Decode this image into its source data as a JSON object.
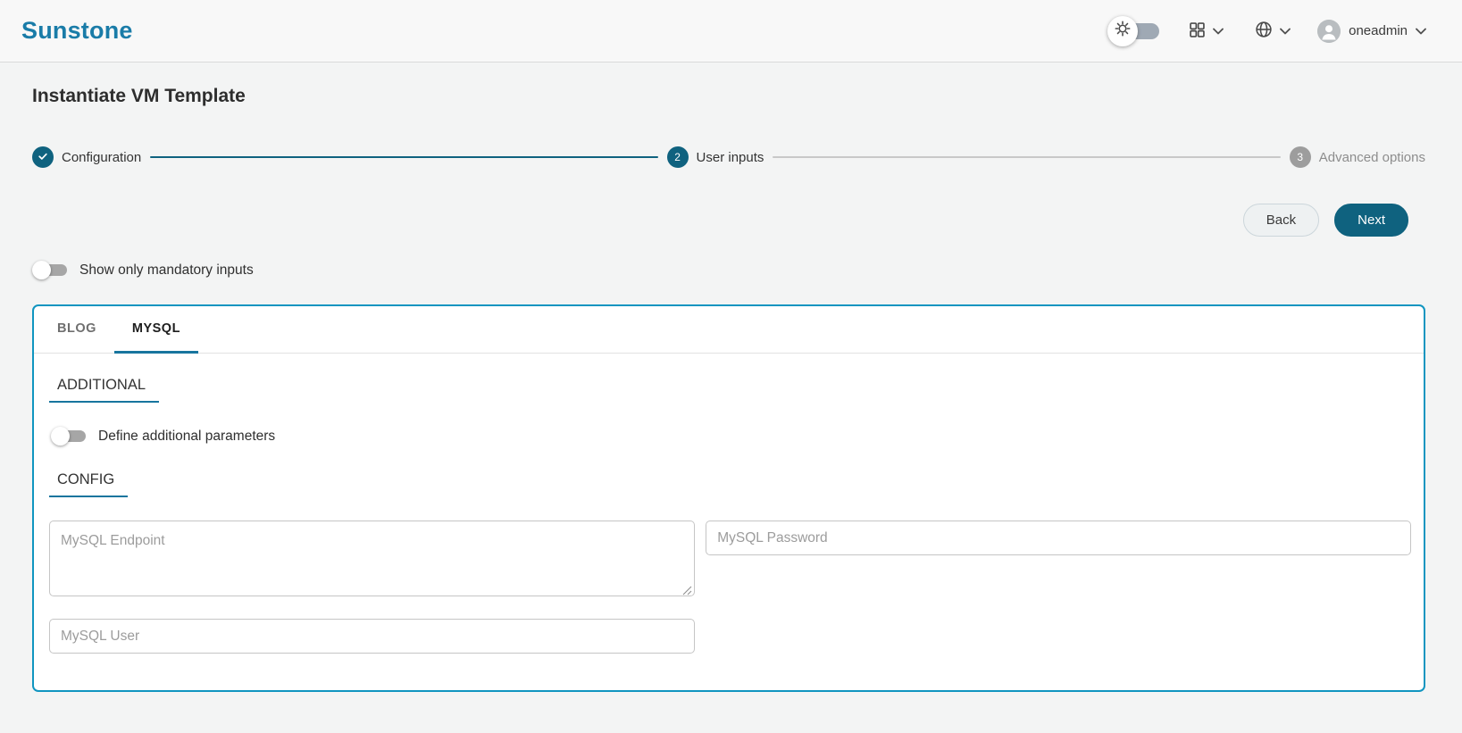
{
  "header": {
    "logo_text": "Sunstone",
    "username": "oneadmin"
  },
  "page_title": "Instantiate VM Template",
  "stepper": {
    "steps": [
      {
        "label": "Configuration",
        "status": "completed"
      },
      {
        "number": "2",
        "label": "User inputs",
        "status": "active"
      },
      {
        "number": "3",
        "label": "Advanced options",
        "status": "upcoming"
      }
    ]
  },
  "wizard_actions": {
    "back": "Back",
    "next": "Next"
  },
  "mandatory_toggle": {
    "label": "Show only mandatory inputs",
    "enabled": false
  },
  "user_inputs_card": {
    "tabs": [
      {
        "label": "BLOG",
        "active": false
      },
      {
        "label": "MYSQL",
        "active": true
      }
    ],
    "additional_section": {
      "title": "ADDITIONAL",
      "toggle_label": "Define additional parameters",
      "toggle_enabled": false
    },
    "config_section": {
      "title": "CONFIG",
      "fields": {
        "endpoint": {
          "placeholder": "MySQL Endpoint",
          "value": "",
          "type": "textarea"
        },
        "password": {
          "placeholder": "MySQL Password",
          "value": "",
          "type": "text"
        },
        "user": {
          "placeholder": "MySQL User",
          "value": "",
          "type": "text"
        }
      }
    }
  },
  "icons": {
    "theme": "sun-icon",
    "apps": "grid-icon",
    "language": "globe-icon",
    "user": "avatar-icon",
    "dropdown": "chevron-down-icon",
    "step_done": "check-icon"
  },
  "colors": {
    "brand": "#1a7ca8",
    "primary_dark": "#0f627f",
    "card_border": "#1095c0",
    "underline": "#17759e",
    "page_background": "#f3f4f4"
  }
}
